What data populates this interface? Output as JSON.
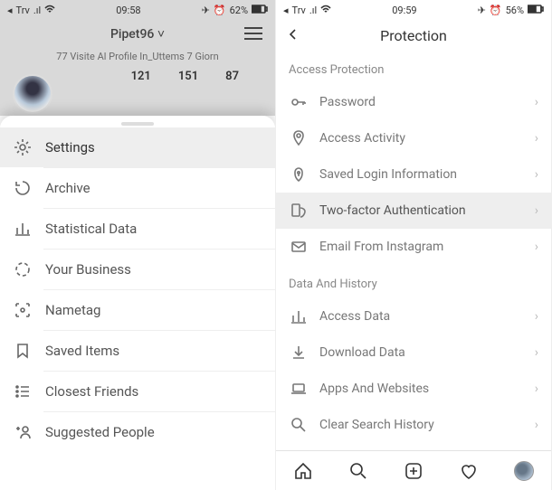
{
  "left": {
    "statusbar": {
      "carrier": "Trv",
      "time": "09:58",
      "battery": "62%"
    },
    "username": "Pipet96",
    "visits_line": "77 Visite Al Profile In_Uttems 7 Giorn",
    "stats": [
      "121",
      "151",
      "87"
    ],
    "menu": [
      {
        "label": "Settings"
      },
      {
        "label": "Archive"
      },
      {
        "label": "Statistical Data"
      },
      {
        "label": "Your Business"
      },
      {
        "label": "Nametag"
      },
      {
        "label": "Saved Items"
      },
      {
        "label": "Closest Friends"
      },
      {
        "label": "Suggested People"
      }
    ]
  },
  "right": {
    "statusbar": {
      "carrier": "Trv",
      "time": "09:59",
      "battery": "56%"
    },
    "title": "Protection",
    "section1": "Access Protection",
    "items1": [
      {
        "label": "Password"
      },
      {
        "label": "Access Activity"
      },
      {
        "label": "Saved Login Information"
      },
      {
        "label": "Two-factor Authentication"
      },
      {
        "label": "Email From Instagram"
      }
    ],
    "section2": "Data And History",
    "items2": [
      {
        "label": "Access Data"
      },
      {
        "label": "Download Data"
      },
      {
        "label": "Apps And Websites"
      },
      {
        "label": "Clear Search History"
      }
    ]
  }
}
